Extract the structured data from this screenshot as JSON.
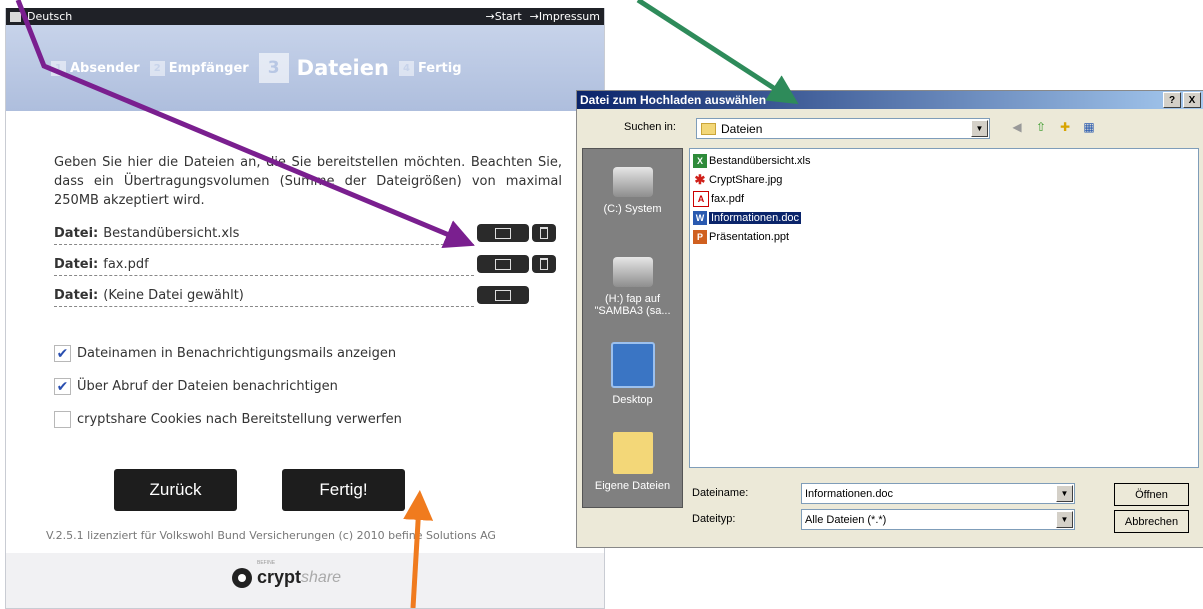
{
  "topbar": {
    "language": "Deutsch",
    "link_start": "→Start",
    "link_impressum": "→Impressum"
  },
  "steps": [
    {
      "num": "1",
      "label": "Absender"
    },
    {
      "num": "2",
      "label": "Empfänger"
    },
    {
      "num": "3",
      "label": "Dateien"
    },
    {
      "num": "4",
      "label": "Fertig"
    }
  ],
  "intro": "Geben Sie hier die Dateien an, die Sie bereitstellen möchten. Beachten Sie, dass ein Übertragungsvolumen (Summe der Dateigrößen) von maximal 250MB akzeptiert wird.",
  "files": [
    {
      "label": "Datei:",
      "value": "Bestandübersicht.xls"
    },
    {
      "label": "Datei:",
      "value": "fax.pdf"
    },
    {
      "label": "Datei:",
      "value": "(Keine Datei gewählt)"
    }
  ],
  "options": [
    {
      "checked": true,
      "label": "Dateinamen in Benachrichtigungsmails anzeigen"
    },
    {
      "checked": true,
      "label": "Über Abruf der Dateien benachrichtigen"
    },
    {
      "checked": false,
      "label": "cryptshare Cookies nach Bereitstellung verwerfen"
    }
  ],
  "buttons": {
    "back": "Zurück",
    "finish": "Fertig!"
  },
  "footer": "V.2.5.1 lizenziert für Volkswohl Bund Versicherungen (c) 2010 befine Solutions AG",
  "logo": {
    "crypt": "crypt",
    "share": "share",
    "sup": "BEFINE"
  },
  "dialog": {
    "title": "Datei zum Hochladen auswählen",
    "help_btn": "?",
    "close_btn": "X",
    "look_in_label": "Suchen in:",
    "look_in_value": "Dateien",
    "places": [
      "(C:) System",
      "(H:) fap auf \"SAMBA3 (sa...",
      "Desktop",
      "Eigene Dateien"
    ],
    "files": [
      {
        "name": "Bestandübersicht.xls",
        "type": "xls",
        "selected": false
      },
      {
        "name": "CryptShare.jpg",
        "type": "jpg",
        "selected": false
      },
      {
        "name": "fax.pdf",
        "type": "pdf",
        "selected": false
      },
      {
        "name": "Informationen.doc",
        "type": "doc",
        "selected": true
      },
      {
        "name": "Präsentation.ppt",
        "type": "ppt",
        "selected": false
      }
    ],
    "filename_label": "Dateiname:",
    "filename_value": "Informationen.doc",
    "filetype_label": "Dateityp:",
    "filetype_value": "Alle Dateien (*.*)",
    "open_btn": "Öffnen",
    "cancel_btn": "Abbrechen"
  },
  "colors": {
    "arrow_purple": "#7a1f8f",
    "arrow_green": "#2e8b5a",
    "arrow_orange": "#f07b1e",
    "dialog_title": "#0a246a"
  }
}
